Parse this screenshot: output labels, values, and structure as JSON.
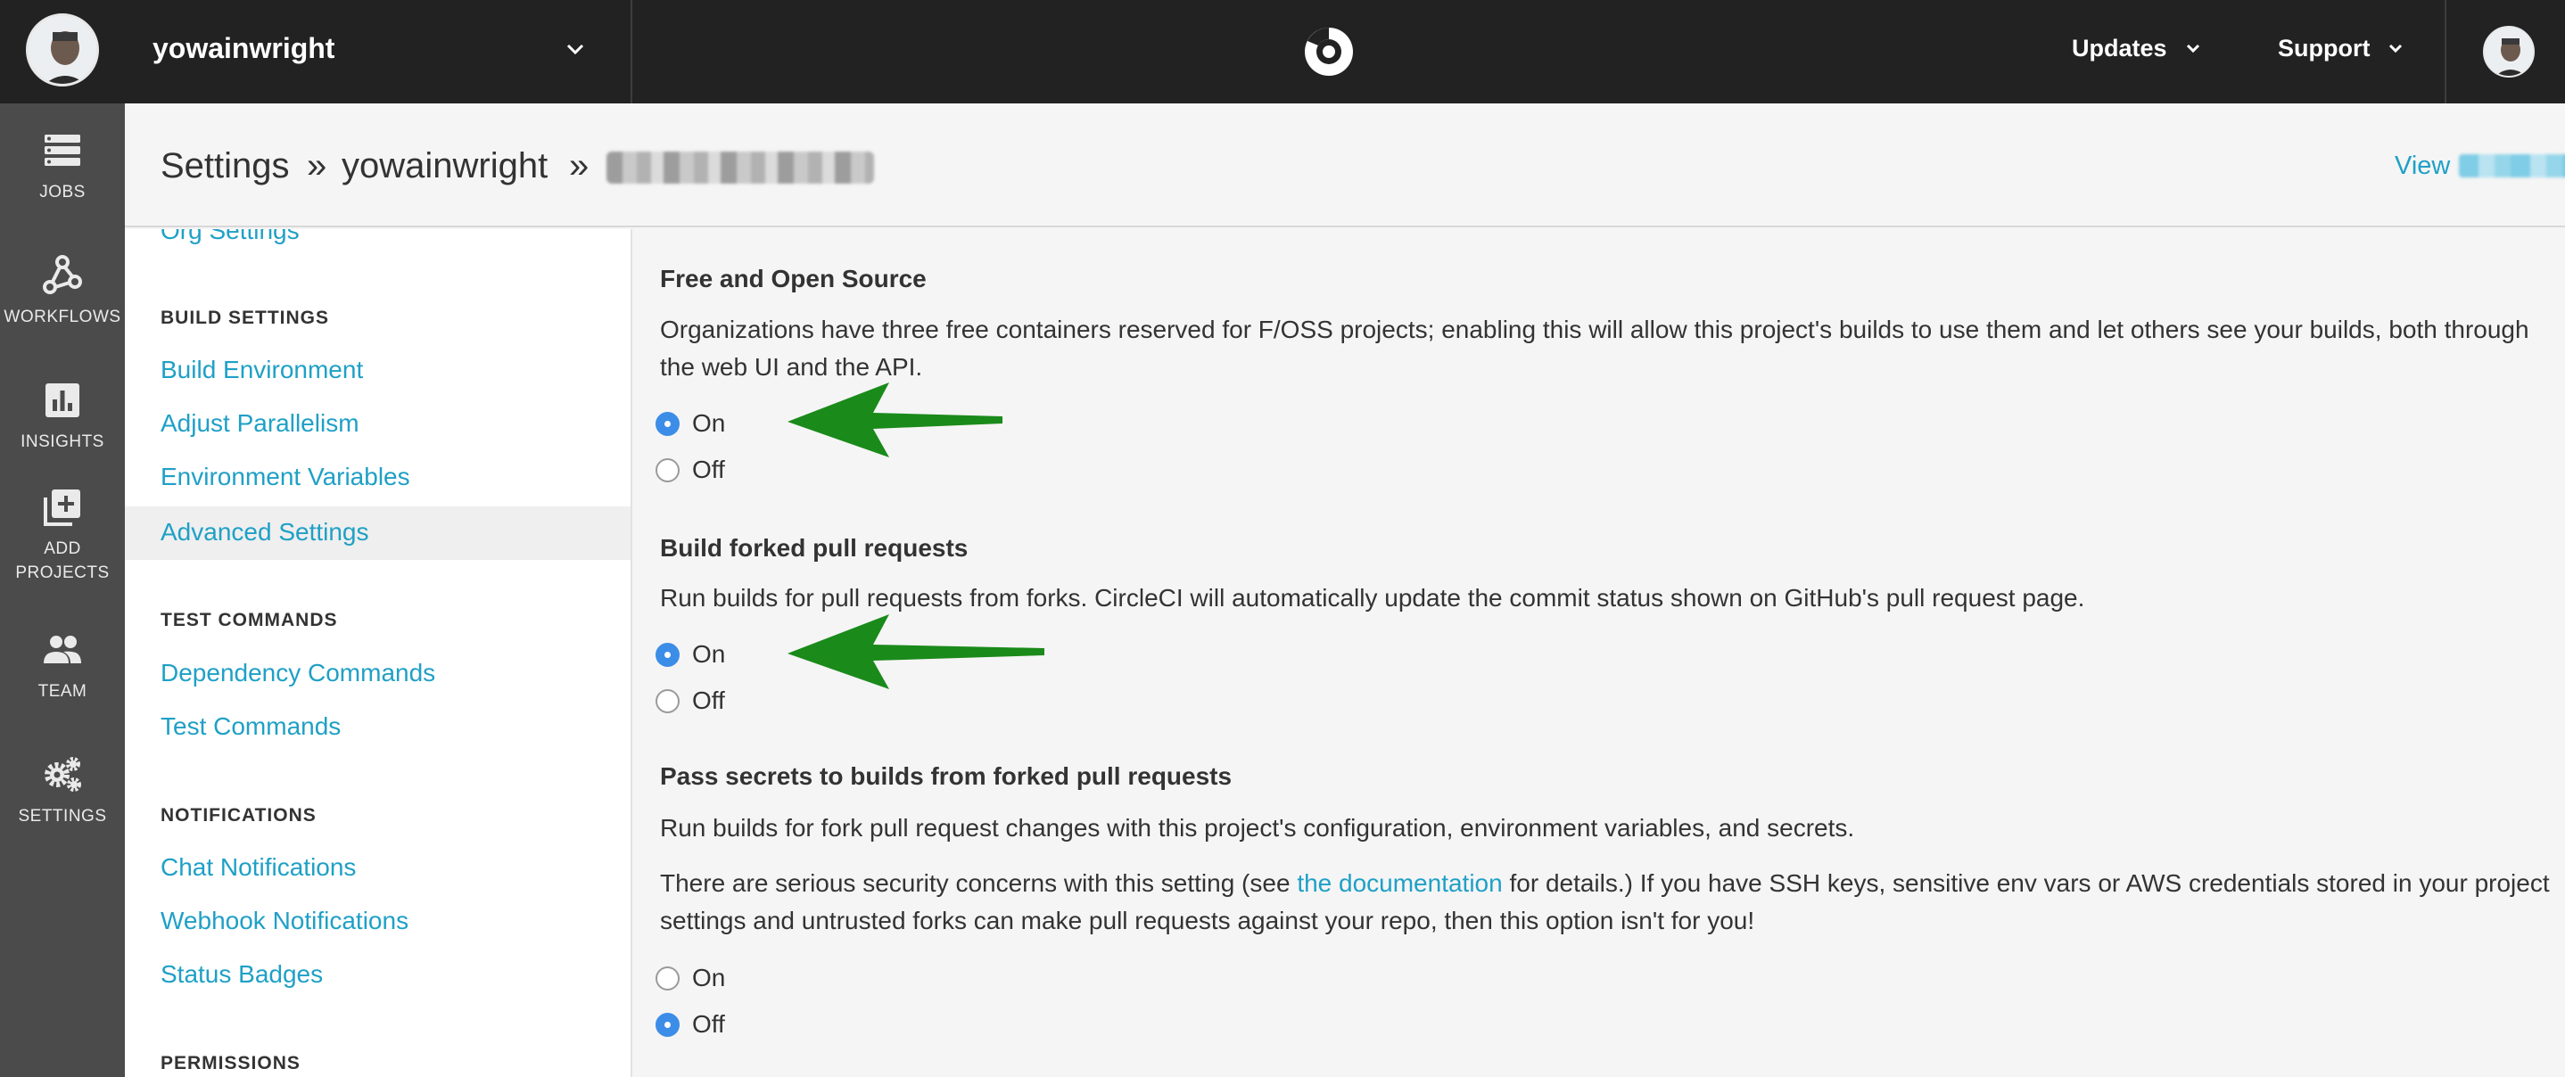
{
  "topbar": {
    "org_name": "yowainwright",
    "updates_label": "Updates",
    "support_label": "Support"
  },
  "leftnav": {
    "items": [
      {
        "label": "JOBS",
        "icon": "jobs-icon"
      },
      {
        "label": "WORKFLOWS",
        "icon": "workflows-icon"
      },
      {
        "label": "INSIGHTS",
        "icon": "insights-icon"
      },
      {
        "label_line1": "ADD",
        "label_line2": "PROJECTS",
        "icon": "add-projects-icon"
      },
      {
        "label": "TEAM",
        "icon": "team-icon"
      },
      {
        "label": "SETTINGS",
        "icon": "settings-icon"
      }
    ]
  },
  "header": {
    "crumb_settings": "Settings",
    "separator": "»",
    "crumb_org": "yowainwright",
    "view_label": "View",
    "view_suffix": "»"
  },
  "sidebar": {
    "org_settings": "Org Settings",
    "build_settings_heading": "BUILD SETTINGS",
    "build_environment": "Build Environment",
    "adjust_parallelism": "Adjust Parallelism",
    "environment_variables": "Environment Variables",
    "advanced_settings": "Advanced Settings",
    "test_commands_heading": "TEST COMMANDS",
    "dependency_commands": "Dependency Commands",
    "test_commands": "Test Commands",
    "notifications_heading": "NOTIFICATIONS",
    "chat_notifications": "Chat Notifications",
    "webhook_notifications": "Webhook Notifications",
    "status_badges": "Status Badges",
    "permissions_heading": "PERMISSIONS"
  },
  "main": {
    "foss": {
      "title": "Free and Open Source",
      "description": "Organizations have three free containers reserved for F/OSS projects; enabling this will allow this project's builds to use them and let others see your builds, both through the web UI and the API.",
      "on_label": "On",
      "off_label": "Off",
      "selected": "On"
    },
    "forked_prs": {
      "title": "Build forked pull requests",
      "description": "Run builds for pull requests from forks. CircleCI will automatically update the commit status shown on GitHub's pull request page.",
      "on_label": "On",
      "off_label": "Off",
      "selected": "On"
    },
    "pass_secrets": {
      "title": "Pass secrets to builds from forked pull requests",
      "description": "Run builds for fork pull request changes with this project's configuration, environment variables, and secrets.",
      "warning_before": "There are serious security concerns with this setting (see ",
      "warning_link": "the documentation",
      "warning_after": " for details.) If you have SSH keys, sensitive env vars or AWS credentials stored in your project settings and untrusted forks can make pull requests against your repo, then this option isn't for you!",
      "on_label": "On",
      "off_label": "Off",
      "selected": "Off"
    }
  },
  "colors": {
    "topbar_bg": "#222222",
    "leftnav_bg": "#4b4b4b",
    "link": "#1fa0c6",
    "radio_checked": "#3c8de8",
    "annotation_arrow": "#1a8a1a"
  }
}
